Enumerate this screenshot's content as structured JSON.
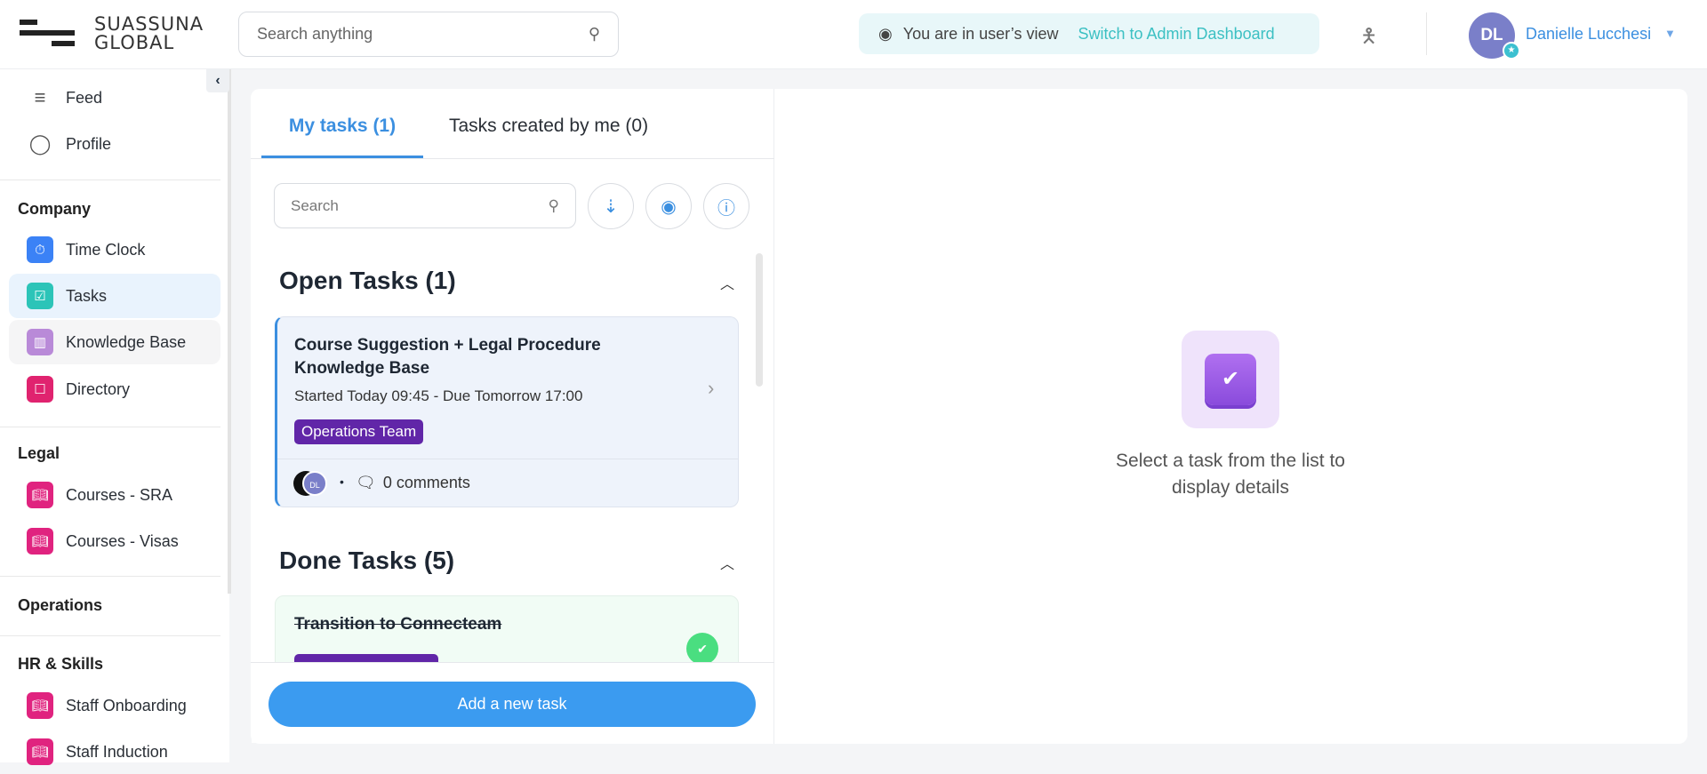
{
  "header": {
    "brand_line1": "SUASSUNA",
    "brand_line2": "GLOBAL",
    "search_placeholder": "Search anything",
    "view_notice": "You are in user’s view",
    "switch_link": "Switch to Admin Dashboard",
    "user_initials": "DL",
    "user_name": "Danielle Lucchesi"
  },
  "sidebar": {
    "feed": "Feed",
    "profile": "Profile",
    "sections": [
      {
        "title": "Company",
        "items": [
          "Time Clock",
          "Tasks",
          "Knowledge Base",
          "Directory"
        ]
      },
      {
        "title": "Legal",
        "items": [
          "Courses - SRA",
          "Courses - Visas"
        ]
      },
      {
        "title": "Operations",
        "items": []
      },
      {
        "title": "HR & Skills",
        "items": [
          "Staff Onboarding",
          "Staff Induction"
        ]
      }
    ]
  },
  "tasks": {
    "tab_mine": "My tasks (1)",
    "tab_created": "Tasks created by me (0)",
    "search_placeholder": "Search",
    "open_heading": "Open Tasks (1)",
    "done_heading": "Done Tasks (5)",
    "open_task": {
      "title": "Course Suggestion + Legal Procedure Knowledge Base",
      "dates": "Started Today 09:45 - Due Tomorrow 17:00",
      "tag": "Operations Team",
      "assignee_initials": "DL",
      "comments": "0 comments"
    },
    "done_task": {
      "title": "Transition to Connecteam"
    },
    "add_button": "Add a new task"
  },
  "detail": {
    "empty_text": "Select a task from the list to display details"
  },
  "colors": {
    "accent": "#3b9bf0",
    "tag": "#6126a8",
    "teal": "#3cc0c3"
  }
}
